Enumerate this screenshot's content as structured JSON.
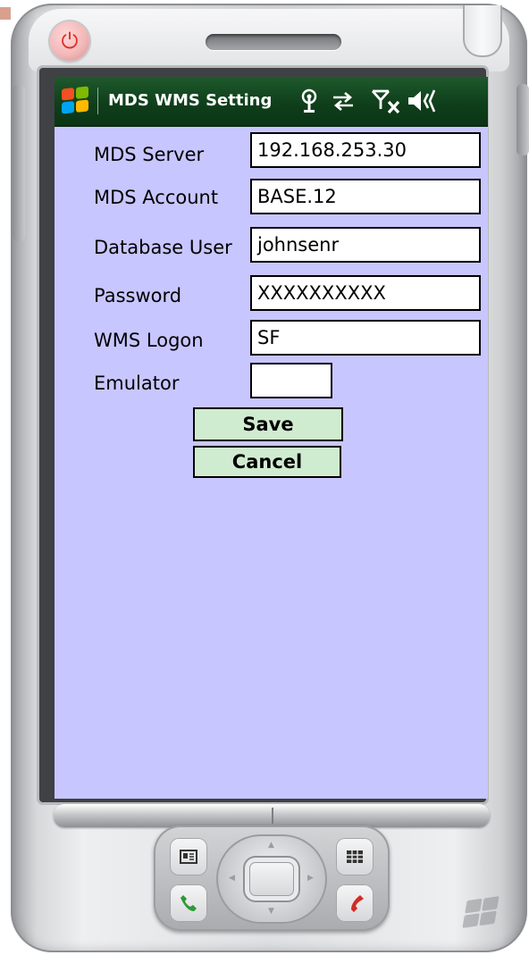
{
  "status_bar": {
    "title": "MDS WMS Setting",
    "icons": [
      "start-flag-icon",
      "antenna-icon",
      "sync-icon",
      "phone-off-icon",
      "speaker-icon"
    ]
  },
  "form": {
    "fields": [
      {
        "label": "MDS Server",
        "value": "192.168.253.30"
      },
      {
        "label": "MDS Account",
        "value": "BASE.12"
      },
      {
        "label": "Database User",
        "value": "johnsenr"
      },
      {
        "label": "Password",
        "value": "XXXXXXXXXX"
      },
      {
        "label": "WMS Logon",
        "value": "SF"
      },
      {
        "label": "Emulator",
        "value": ""
      }
    ],
    "save_label": "Save",
    "cancel_label": "Cancel"
  },
  "colors": {
    "screen_background": "#c8c6fe",
    "status_bar": "#0f3f1b",
    "button_fill": "#d0ecd0",
    "power_button": "#e0302a"
  },
  "device_icons": [
    "power-icon",
    "contacts-icon",
    "calendar-icon",
    "call-icon",
    "end-call-icon",
    "windows-logo-icon"
  ]
}
